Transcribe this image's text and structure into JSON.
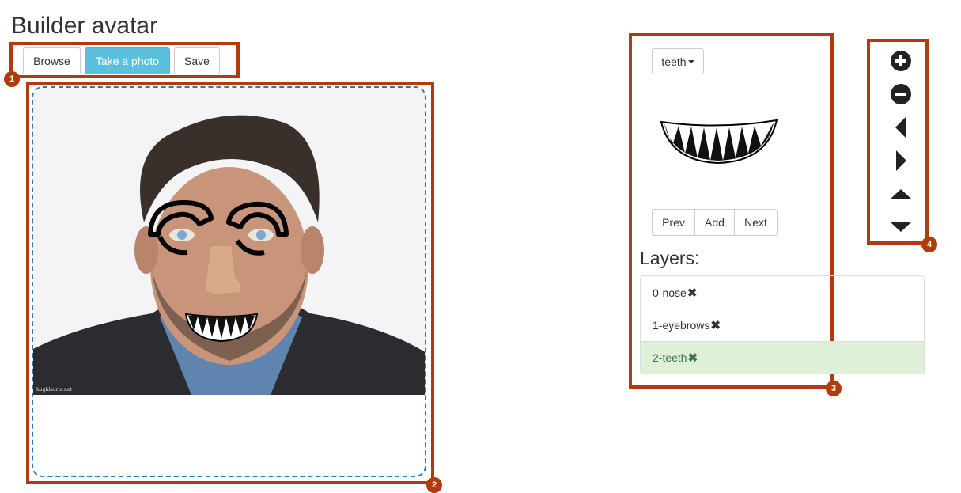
{
  "page": {
    "title": "Builder avatar"
  },
  "toolbar": {
    "browse_label": "Browse",
    "take_photo_label": "Take a photo",
    "save_label": "Save"
  },
  "canvas": {
    "watermark": "hughlaurie.net"
  },
  "part_selector": {
    "selected": "teeth"
  },
  "part_nav": {
    "prev_label": "Prev",
    "add_label": "Add",
    "next_label": "Next"
  },
  "layers": {
    "heading": "Layers:",
    "items": [
      {
        "label": "0-nose",
        "remove_glyph": "✖",
        "active": false
      },
      {
        "label": "1-eyebrows",
        "remove_glyph": "✖",
        "active": false
      },
      {
        "label": "2-teeth",
        "remove_glyph": "✖",
        "active": true
      }
    ]
  },
  "controls": [
    "zoom-in-icon",
    "zoom-out-icon",
    "move-left-icon",
    "move-right-icon",
    "move-up-icon",
    "move-down-icon"
  ],
  "annotations": {
    "a1": "1",
    "a2": "2",
    "a3": "3",
    "a4": "4"
  },
  "colors": {
    "accent": "#5bc0de",
    "annotation": "#b23a0c",
    "active_row": "#dff0d8",
    "active_text": "#3c763d",
    "canvas_border": "#2a7ab8"
  }
}
